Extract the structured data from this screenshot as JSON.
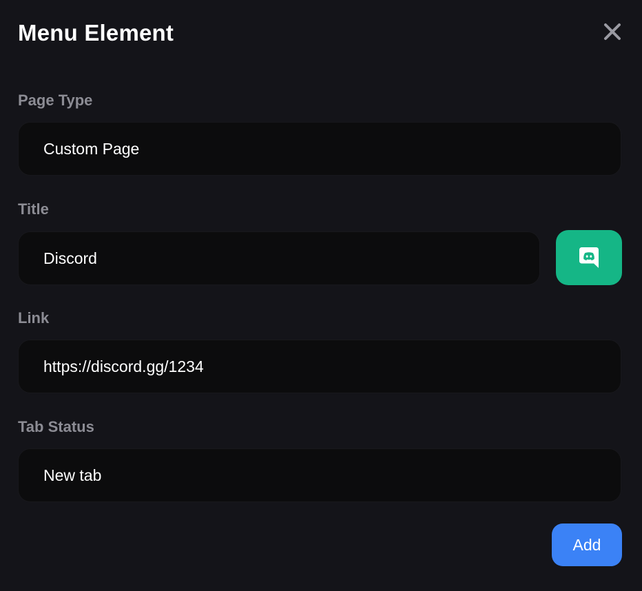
{
  "modal": {
    "title": "Menu Element"
  },
  "page_type": {
    "label": "Page Type",
    "value": "Custom Page"
  },
  "title_field": {
    "label": "Title",
    "value": "Discord",
    "icon": "discord-icon",
    "icon_button_color": "#15b686"
  },
  "link": {
    "label": "Link",
    "value": "https://discord.gg/1234"
  },
  "tab_status": {
    "label": "Tab Status",
    "value": "New tab"
  },
  "actions": {
    "add_label": "Add",
    "add_color": "#3b82f6"
  },
  "colors": {
    "background": "#141419",
    "field_background": "#0c0c0d",
    "label_text": "#8c8c94"
  }
}
